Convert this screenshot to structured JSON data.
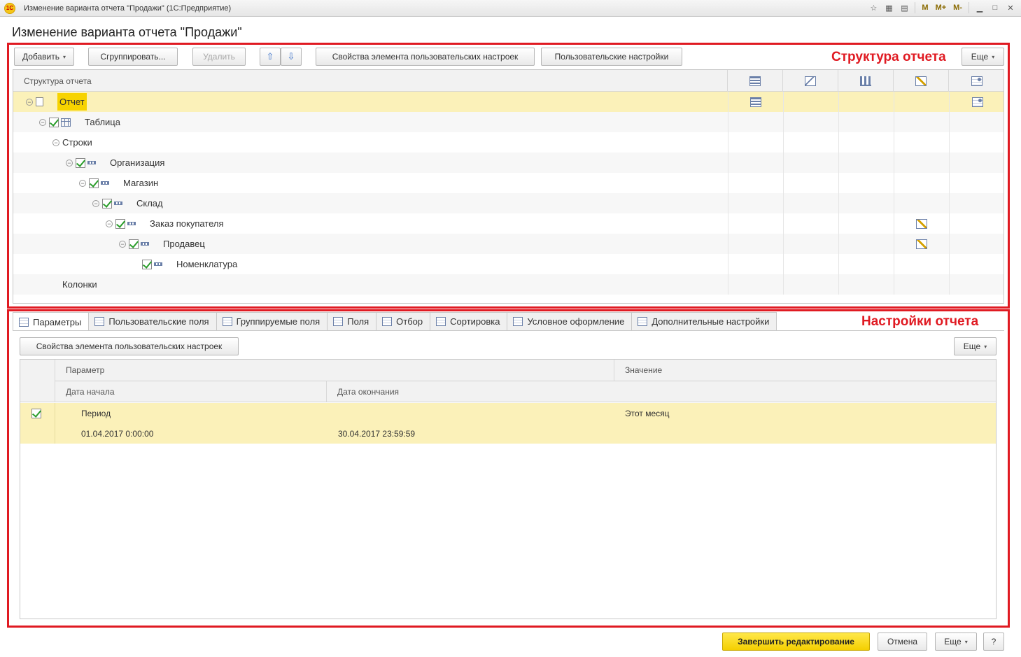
{
  "window": {
    "title": "Изменение варианта отчета \"Продажи\"  (1С:Предприятие)",
    "logo_text": "1С",
    "memory_buttons": [
      "M",
      "M+",
      "M-"
    ]
  },
  "form": {
    "title": "Изменение варианта отчета \"Продажи\""
  },
  "structure": {
    "label": "Структура отчета",
    "toolbar": {
      "add": "Добавить",
      "group": "Сгруппировать...",
      "delete": "Удалить",
      "element_props": "Свойства элемента пользовательских настроек",
      "user_settings": "Пользовательские настройки",
      "more": "Еще"
    },
    "header": {
      "name_col": "Структура отчета",
      "columns": [
        "fields-icon",
        "filter-icon",
        "sort-icon",
        "conditional-format-icon",
        "other-settings-icon"
      ]
    },
    "rows": [
      {
        "label": "Отчет",
        "level": 0,
        "expander": true,
        "check": false,
        "icon": "report-doc-icon",
        "selected": true,
        "cols": [
          true,
          false,
          false,
          false,
          true
        ]
      },
      {
        "label": "Таблица",
        "level": 1,
        "expander": true,
        "check": true,
        "icon": "table-icon",
        "selected": false,
        "cols": [
          false,
          false,
          false,
          false,
          false
        ]
      },
      {
        "label": "Строки",
        "level": 2,
        "expander": true,
        "check": false,
        "icon": "",
        "selected": false,
        "cols": [
          false,
          false,
          false,
          false,
          false
        ]
      },
      {
        "label": "Организация",
        "level": 3,
        "expander": true,
        "check": true,
        "icon": "grouping-icon",
        "selected": false,
        "cols": [
          false,
          false,
          false,
          false,
          false
        ]
      },
      {
        "label": "Магазин",
        "level": 4,
        "expander": true,
        "check": true,
        "icon": "grouping-icon",
        "selected": false,
        "cols": [
          false,
          false,
          false,
          false,
          false
        ]
      },
      {
        "label": "Склад",
        "level": 5,
        "expander": true,
        "check": true,
        "icon": "grouping-icon",
        "selected": false,
        "cols": [
          false,
          false,
          false,
          false,
          false
        ]
      },
      {
        "label": "Заказ покупателя",
        "level": 6,
        "expander": true,
        "check": true,
        "icon": "grouping-icon",
        "selected": false,
        "cols": [
          false,
          false,
          false,
          true,
          false
        ]
      },
      {
        "label": "Продавец",
        "level": 7,
        "expander": true,
        "check": true,
        "icon": "grouping-icon",
        "selected": false,
        "cols": [
          false,
          false,
          false,
          true,
          false
        ]
      },
      {
        "label": "Номенклатура",
        "level": 8,
        "expander": false,
        "check": true,
        "icon": "grouping-icon",
        "selected": false,
        "cols": [
          false,
          false,
          false,
          false,
          false
        ]
      },
      {
        "label": "Колонки",
        "level": 2,
        "expander": false,
        "check": false,
        "icon": "",
        "selected": false,
        "cols": [
          false,
          false,
          false,
          false,
          false
        ]
      }
    ]
  },
  "settings": {
    "label": "Настройки отчета",
    "tabs": [
      {
        "label": "Параметры",
        "active": true
      },
      {
        "label": "Пользовательские поля",
        "active": false
      },
      {
        "label": "Группируемые поля",
        "active": false
      },
      {
        "label": "Поля",
        "active": false
      },
      {
        "label": "Отбор",
        "active": false
      },
      {
        "label": "Сортировка",
        "active": false
      },
      {
        "label": "Условное оформление",
        "active": false
      },
      {
        "label": "Дополнительные настройки",
        "active": false
      }
    ],
    "element_props": "Свойства элемента пользовательских настроек",
    "more": "Еще",
    "table": {
      "headers": {
        "param": "Параметр",
        "value": "Значение",
        "start": "Дата начала",
        "end": "Дата окончания"
      },
      "row": {
        "checked": true,
        "name": "Период",
        "value": "Этот месяц",
        "start": "01.04.2017 0:00:00",
        "end": "30.04.2017 23:59:59"
      }
    }
  },
  "footer": {
    "finish": "Завершить редактирование",
    "cancel": "Отмена",
    "more": "Еще",
    "help": "?"
  },
  "colors": {
    "accent_red": "#e01a22",
    "selection_yellow": "#fbf1b9",
    "primary_button": "#f4cf00"
  }
}
